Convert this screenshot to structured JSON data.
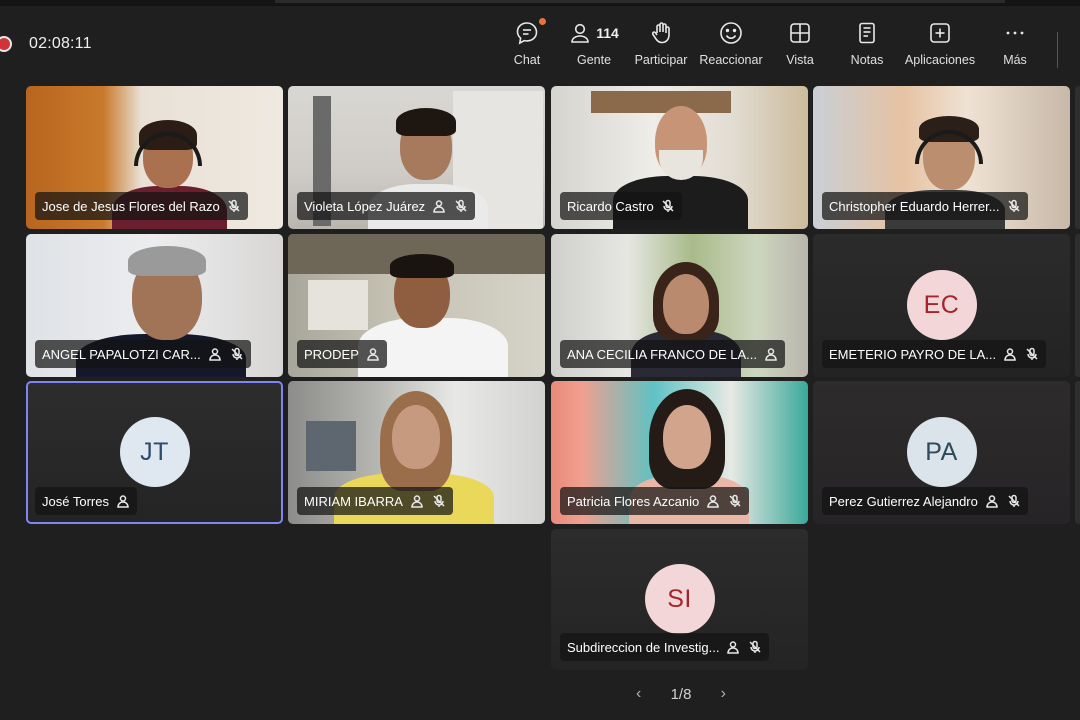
{
  "meeting": {
    "timer": "02:08:11",
    "people_count": "114"
  },
  "toolbar": {
    "items": [
      {
        "label": "Chat",
        "icon": "chat-icon"
      },
      {
        "label": "Gente",
        "icon": "people-icon"
      },
      {
        "label": "Participar",
        "icon": "raise-hand-icon"
      },
      {
        "label": "Reaccionar",
        "icon": "smiley-icon"
      },
      {
        "label": "Vista",
        "icon": "grid-view-icon"
      },
      {
        "label": "Notas",
        "icon": "notes-icon"
      },
      {
        "label": "Aplicaciones",
        "icon": "add-apps-icon"
      },
      {
        "label": "Más",
        "icon": "more-icon"
      }
    ]
  },
  "participants": [
    {
      "name": "Jose de Jesus Flores del Razo",
      "video": true,
      "muted": true,
      "spotlight_icon": false
    },
    {
      "name": "Violeta López Juárez",
      "video": true,
      "muted": true,
      "spotlight_icon": true
    },
    {
      "name": "Ricardo Castro",
      "video": true,
      "muted": true,
      "spotlight_icon": false
    },
    {
      "name": "Christopher Eduardo Herrer...",
      "video": true,
      "muted": true,
      "spotlight_icon": false
    },
    {
      "name": "ANGEL PAPALOTZI CAR...",
      "video": true,
      "muted": true,
      "spotlight_icon": true
    },
    {
      "name": "PRODEP",
      "video": true,
      "muted": false,
      "spotlight_icon": true
    },
    {
      "name": "ANA CECILIA FRANCO DE LA...",
      "video": true,
      "muted": false,
      "spotlight_icon": true
    },
    {
      "name": "EMETERIO PAYRO DE LA...",
      "video": false,
      "initials": "EC",
      "muted": true,
      "spotlight_icon": true
    },
    {
      "name": "José Torres",
      "video": false,
      "initials": "JT",
      "muted": false,
      "spotlight_icon": true,
      "active": true
    },
    {
      "name": "MIRIAM IBARRA",
      "video": true,
      "muted": true,
      "spotlight_icon": true
    },
    {
      "name": "Patricia Flores Azcanio",
      "video": true,
      "muted": true,
      "spotlight_icon": true
    },
    {
      "name": "Perez Gutierrez Alejandro",
      "video": false,
      "initials": "PA",
      "muted": true,
      "spotlight_icon": true
    },
    {
      "name": "Subdireccion de Investig...",
      "video": false,
      "initials": "SI",
      "muted": true,
      "spotlight_icon": true
    }
  ],
  "pager": {
    "label": "1/8"
  },
  "colors": {
    "background": "#1f1f1f",
    "active_outline": "#7f85f5",
    "recording": "#d13438",
    "avatar_ec": "#f3d6d8",
    "avatar_jt": "#dfe7f0",
    "avatar_pa": "#dbe4ea",
    "avatar_si": "#f3d6d8"
  }
}
